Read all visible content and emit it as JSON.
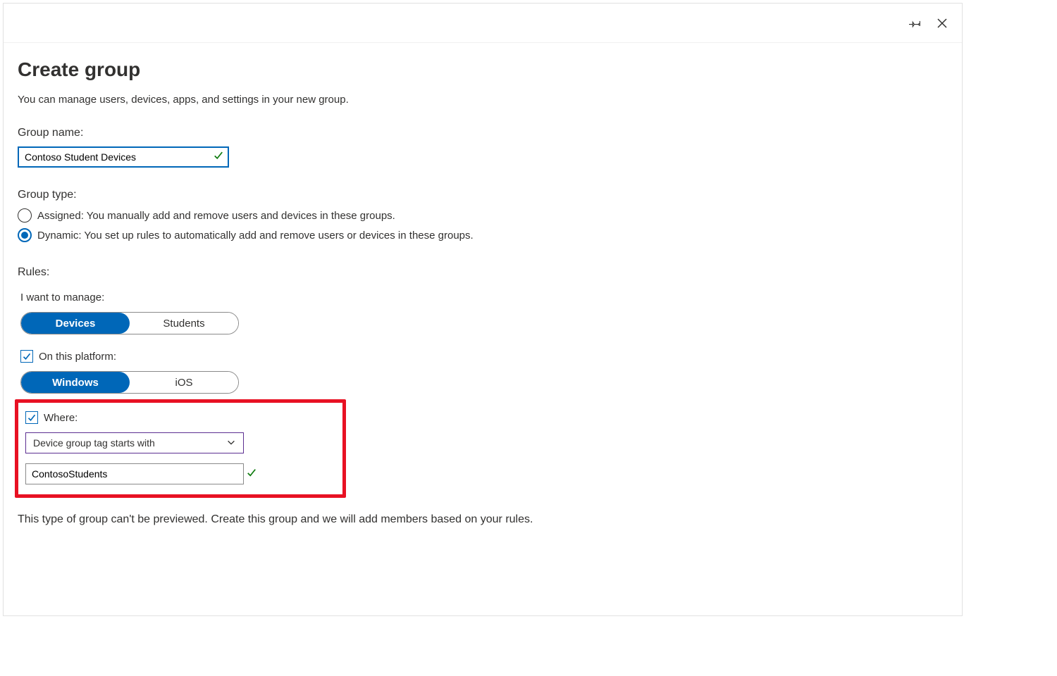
{
  "header": {
    "pin_icon": "pin",
    "close_icon": "close"
  },
  "page": {
    "title": "Create group",
    "subtitle": "You can manage users, devices, apps, and settings in your new group."
  },
  "group_name": {
    "label": "Group name:",
    "value": "Contoso Student Devices"
  },
  "group_type": {
    "label": "Group type:",
    "options": [
      {
        "key": "assigned",
        "label": "Assigned: You manually add and remove users and devices in these groups.",
        "selected": false
      },
      {
        "key": "dynamic",
        "label": "Dynamic: You set up rules to automatically add and remove users or devices in these groups.",
        "selected": true
      }
    ]
  },
  "rules": {
    "label": "Rules:",
    "manage": {
      "label": "I want to manage:",
      "options": {
        "left": "Devices",
        "right": "Students",
        "active": "left"
      }
    },
    "platform": {
      "checkbox_label": "On this platform:",
      "checked": true,
      "options": {
        "left": "Windows",
        "right": "iOS",
        "active": "left"
      }
    },
    "where": {
      "checkbox_label": "Where:",
      "checked": true,
      "dropdown_value": "Device group tag starts with",
      "input_value": "ContosoStudents"
    }
  },
  "preview_note": "This type of group can't be previewed. Create this group and we will add members based on your rules."
}
